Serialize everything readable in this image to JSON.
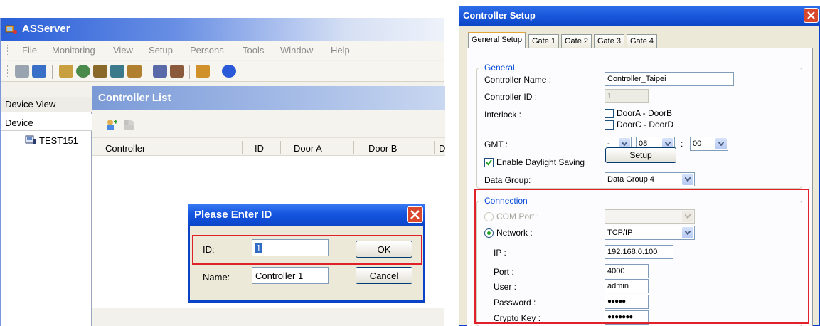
{
  "asserver": {
    "title": "ASServer",
    "menu": [
      "File",
      "Monitoring",
      "View",
      "Setup",
      "Persons",
      "Tools",
      "Window",
      "Help"
    ],
    "device_view": {
      "header": "Device View",
      "column": "Device",
      "node": "TEST151"
    },
    "controller_list": {
      "title": "Controller List",
      "columns": [
        "Controller",
        "ID",
        "Door A",
        "Door B",
        "D"
      ]
    },
    "enter_id_dialog": {
      "title": "Please Enter ID",
      "id_label": "ID:",
      "id_value": "1",
      "name_label": "Name:",
      "name_value": "Controller 1",
      "ok_label": "OK",
      "cancel_label": "Cancel"
    }
  },
  "controller_setup": {
    "title": "Controller Setup",
    "tabs": [
      "General Setup",
      "Gate 1",
      "Gate 2",
      "Gate 3",
      "Gate 4"
    ],
    "general": {
      "legend": "General",
      "controller_name_label": "Controller Name :",
      "controller_name_value": "Controller_Taipei",
      "controller_id_label": "Controller ID :",
      "controller_id_value": "1",
      "interlock_label": "Interlock :",
      "interlock_option_1": "DoorA - DoorB",
      "interlock_option_2": "DoorC - DoorD",
      "gmt_label": "GMT :",
      "gmt_sign": "-",
      "gmt_hour": "08",
      "gmt_colon": ":",
      "gmt_minute": "00",
      "daylight_label": "Enable Daylight Saving",
      "setup_button": "Setup",
      "data_group_label": "Data Group:",
      "data_group_value": "Data Group 4"
    },
    "connection": {
      "legend": "Connection",
      "com_port_label": "COM Port :",
      "network_label": "Network :",
      "network_value": "TCP/IP",
      "ip_label": "IP :",
      "ip_value": "192.168.0.100",
      "port_label": "Port :",
      "port_value": "4000",
      "user_label": "User :",
      "user_value": "admin",
      "password_label": "Password :",
      "password_value": "●●●●●",
      "crypto_label": "Crypto Key :",
      "crypto_value": "●●●●●●●"
    }
  },
  "colors": {
    "xp_title_blue": "#0a45c8",
    "highlight_red": "#e0202a",
    "group_legend_blue": "#0046d5"
  }
}
